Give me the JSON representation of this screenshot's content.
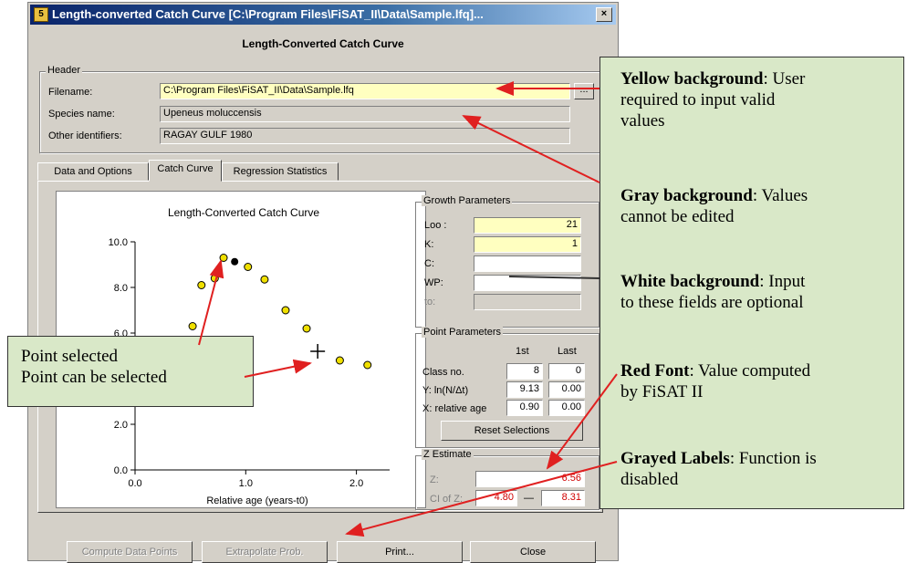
{
  "window": {
    "title": "Length-converted Catch Curve [C:\\Program Files\\FiSAT_II\\Data\\Sample.lfq]...",
    "close_label": "×",
    "app_icon_label": "5",
    "subtitle": "Length-Converted Catch Curve"
  },
  "header": {
    "group_label": "Header",
    "filename_label": "Filename:",
    "filename_value": "C:\\Program Files\\FiSAT_II\\Data\\Sample.lfq",
    "browse_label": "...",
    "species_label": "Species name:",
    "species_value": "Upeneus moluccensis",
    "other_label": "Other identifiers:",
    "other_value": "RAGAY GULF 1980"
  },
  "tabs": [
    {
      "label": "Data and Options"
    },
    {
      "label": "Catch Curve"
    },
    {
      "label": "Regression Statistics"
    }
  ],
  "growth": {
    "group_label": "Growth Parameters",
    "linf_label": "Loo :",
    "linf_value": "21",
    "k_label": "K:",
    "k_value": "1",
    "c_label": "C:",
    "wp_label": "WP:",
    "t0_label": "to:"
  },
  "point": {
    "group_label": "Point Parameters",
    "col_first": "1st",
    "col_last": "Last",
    "class_label": "Class no.",
    "class_first": "8",
    "class_last": "0",
    "y_label": "Y: ln(N/Δt)",
    "y_first": "9.13",
    "y_last": "0.00",
    "x_label": "X: relative age",
    "x_first": "0.90",
    "x_last": "0.00",
    "reset_label": "Reset Selections"
  },
  "z": {
    "group_label": "Z Estimate",
    "z_label": "Z:",
    "z_value": "6.56",
    "ci_label": "CI of Z:",
    "ci_low": "4.80",
    "ci_sep": "—",
    "ci_high": "8.31"
  },
  "buttons": {
    "compute": "Compute Data Points",
    "extrapolate": "Extrapolate Prob.",
    "print": "Print...",
    "close": "Close"
  },
  "colors": {
    "field_yellow": "#ffffc0",
    "field_gray": "#d4d0c8",
    "computed_red": "#d00000",
    "callout_green": "#d9e8c8",
    "arrow_red": "#e02020",
    "point_yellow": "#f0e000"
  },
  "chart_data": {
    "type": "scatter",
    "title": "Length-Converted Catch Curve",
    "xlabel": "Relative age (years-t0)",
    "ylabel": "",
    "xlim": [
      0.0,
      2.3
    ],
    "ylim": [
      0.0,
      10.0
    ],
    "x_ticks": [
      "0.0",
      "1.0",
      "2.0"
    ],
    "y_ticks": [
      "0.0",
      "2.0",
      "4.0",
      "6.0",
      "8.0",
      "10.0"
    ],
    "series": [
      {
        "points": [
          {
            "x": 0.52,
            "y": 6.3,
            "state": "selectable"
          },
          {
            "x": 0.6,
            "y": 8.1,
            "state": "selectable"
          },
          {
            "x": 0.72,
            "y": 8.4,
            "state": "selectable"
          },
          {
            "x": 0.8,
            "y": 9.3,
            "state": "selectable"
          },
          {
            "x": 0.9,
            "y": 9.13,
            "state": "selected"
          },
          {
            "x": 1.02,
            "y": 8.9,
            "state": "selectable"
          },
          {
            "x": 1.17,
            "y": 8.35,
            "state": "selectable"
          },
          {
            "x": 1.36,
            "y": 7.0,
            "state": "selectable"
          },
          {
            "x": 1.55,
            "y": 6.2,
            "state": "selectable"
          },
          {
            "x": 1.65,
            "y": 5.2,
            "state": "cursor"
          },
          {
            "x": 1.85,
            "y": 4.8,
            "state": "selectable"
          },
          {
            "x": 2.1,
            "y": 4.6,
            "state": "selectable"
          }
        ]
      }
    ]
  },
  "callouts": {
    "yellow": {
      "bold": "Yellow background",
      "rest1": ": User",
      "rest2": "required to input valid",
      "rest3": "values"
    },
    "gray": {
      "bold": "Gray background",
      "rest1": ": Values",
      "rest2": "cannot be edited"
    },
    "white": {
      "bold": "White background",
      "rest1": ": Input",
      "rest2": "to these fields are optional"
    },
    "red": {
      "bold": "Red Font",
      "rest1": ": Value computed",
      "rest2": "by FiSAT II"
    },
    "grayed": {
      "bold": "Grayed Labels",
      "rest1": ": Function is",
      "rest2": "disabled"
    },
    "point_line1": "Point selected",
    "point_line2": "Point can be selected"
  }
}
